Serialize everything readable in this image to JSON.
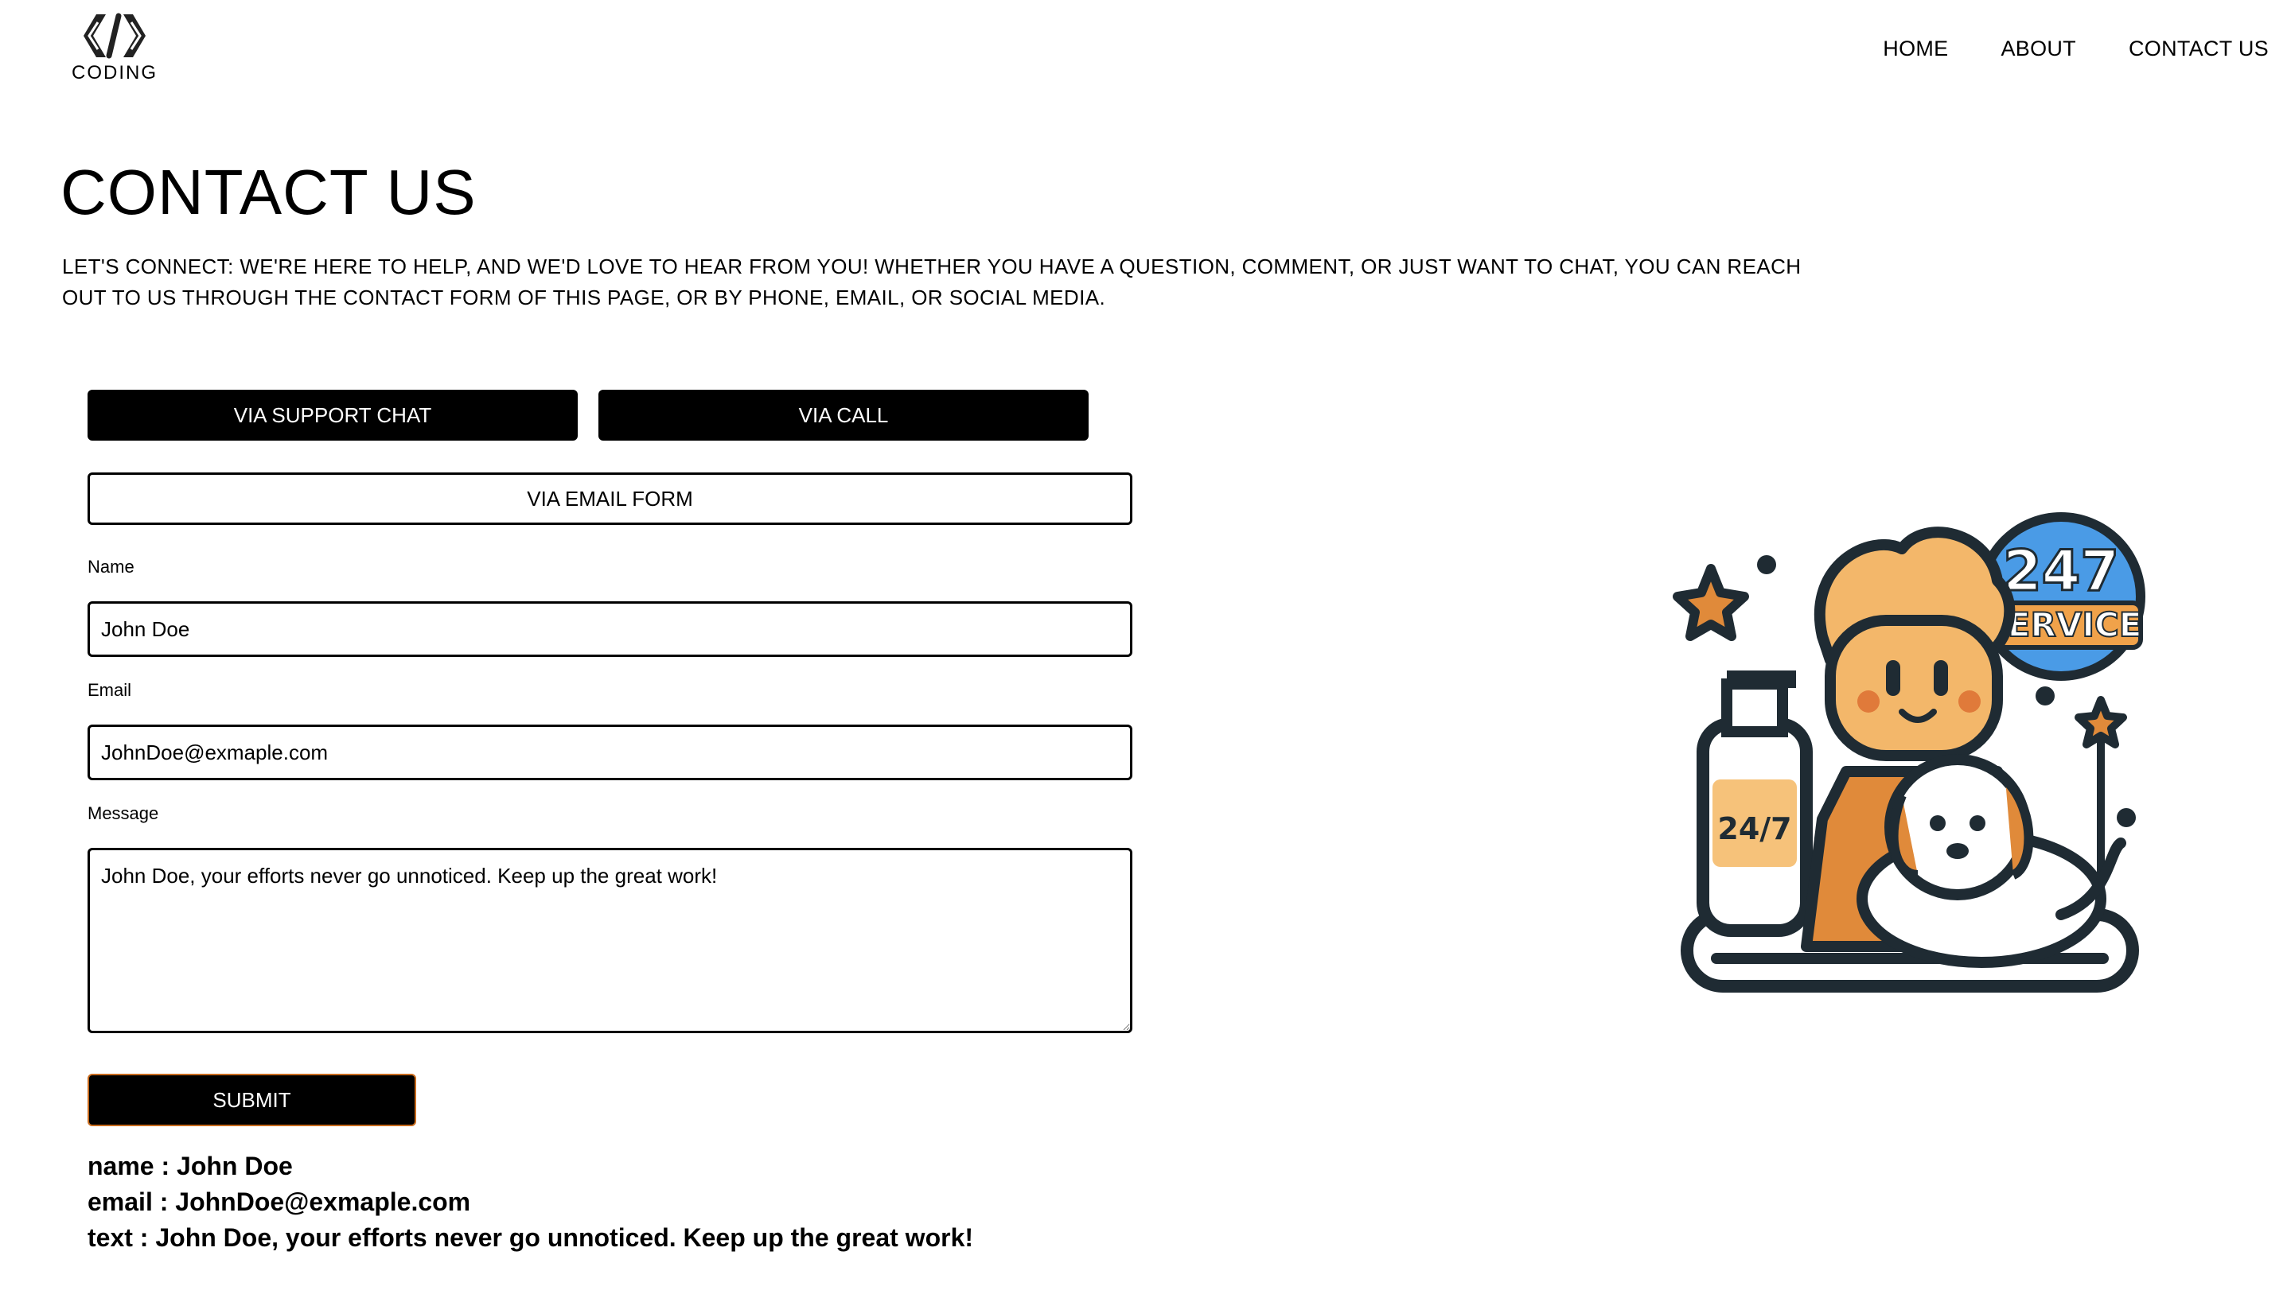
{
  "header": {
    "logo_text": "CODING",
    "nav": [
      "HOME",
      "ABOUT",
      "CONTACT US"
    ]
  },
  "page": {
    "title": "CONTACT US",
    "intro": "LET'S CONNECT: WE'RE HERE TO HELP, AND WE'D LOVE TO HEAR FROM YOU! WHETHER YOU HAVE A QUESTION, COMMENT, OR JUST WANT TO CHAT, YOU CAN REACH OUT TO US THROUGH THE CONTACT FORM OF THIS PAGE, OR BY PHONE, EMAIL, OR SOCIAL MEDIA."
  },
  "options": {
    "chat": "VIA SUPPORT CHAT",
    "call": "VIA CALL",
    "email_form": "VIA EMAIL FORM"
  },
  "form": {
    "name_label": "Name",
    "name_value": "John Doe",
    "email_label": "Email",
    "email_value": "JohnDoe@exmaple.com",
    "message_label": "Message",
    "message_value": "John Doe, your efforts never go unnoticed. Keep up the great work!",
    "submit": "SUBMIT"
  },
  "output": {
    "name": "name : John Doe",
    "email": "email : JohnDoe@exmaple.com",
    "text": "text : John Doe, your efforts never go unnoticed. Keep up the great work!"
  },
  "illustration": {
    "badge_number": "247",
    "badge_text": "SERVICE",
    "bottle_label": "24/7"
  },
  "colors": {
    "primary": "#000000",
    "accent_orange": "#e08a3a",
    "badge_blue": "#4a9be6",
    "outline": "#1f2b33"
  }
}
